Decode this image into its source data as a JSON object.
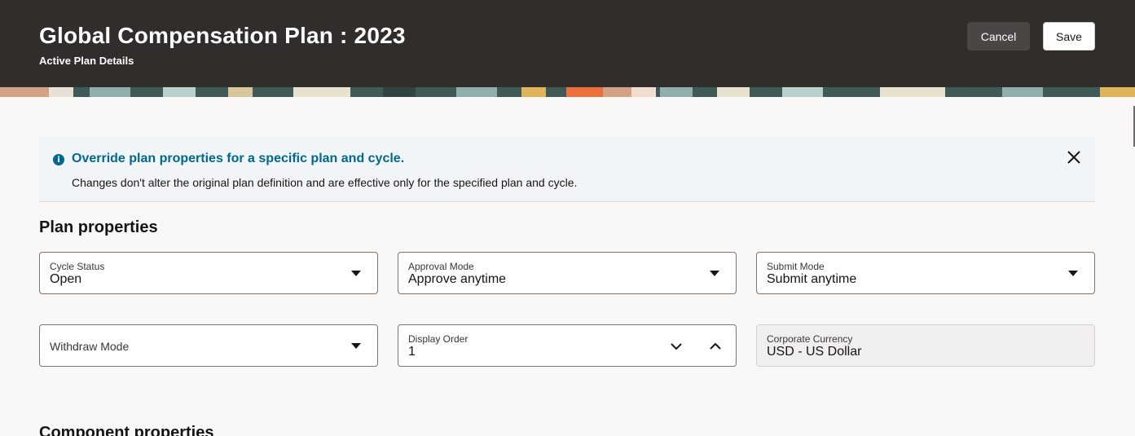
{
  "header": {
    "title": "Global Compensation Plan : 2023",
    "subtitle": "Active Plan Details",
    "cancel_label": "Cancel",
    "save_label": "Save"
  },
  "message": {
    "title": "Override plan properties for a specific plan and cycle.",
    "body": "Changes don't alter the original plan definition and are effective only for the specified plan and cycle.",
    "icon": "info-icon"
  },
  "plan_properties": {
    "heading": "Plan properties",
    "cycle_status": {
      "label": "Cycle Status",
      "value": "Open"
    },
    "approval_mode": {
      "label": "Approval Mode",
      "value": "Approve anytime"
    },
    "submit_mode": {
      "label": "Submit Mode",
      "value": "Submit anytime"
    },
    "withdraw_mode": {
      "label": "Withdraw Mode",
      "value": ""
    },
    "display_order": {
      "label": "Display Order",
      "value": "1"
    },
    "corporate_currency": {
      "label": "Corporate Currency",
      "value": "USD - US Dollar"
    }
  },
  "component_properties": {
    "heading": "Component properties"
  },
  "colors": {
    "header_bg": "#312d2a",
    "accent": "#00688c",
    "page_bg": "#f9f8f6"
  }
}
